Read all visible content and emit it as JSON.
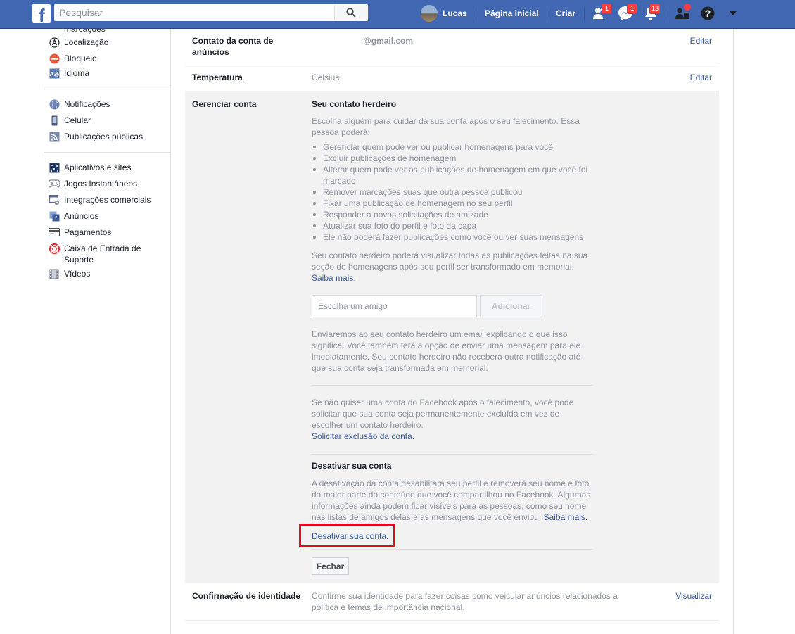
{
  "topbar": {
    "search_placeholder": "Pesquisar",
    "user_name": "Lucas",
    "home_label": "Página inicial",
    "create_label": "Criar",
    "friend_requests_badge": "1",
    "messages_badge": "1",
    "notifications_badge": "13",
    "brand_color": "#4267b2"
  },
  "sidebar": {
    "group1": [
      {
        "label": "marcações",
        "icon": "tag-icon"
      },
      {
        "label": "Localização",
        "icon": "location-icon"
      },
      {
        "label": "Bloqueio",
        "icon": "block-icon"
      },
      {
        "label": "Idioma",
        "icon": "language-icon"
      }
    ],
    "group2": [
      {
        "label": "Notificações",
        "icon": "globe-icon"
      },
      {
        "label": "Celular",
        "icon": "mobile-icon"
      },
      {
        "label": "Publicações públicas",
        "icon": "rss-icon"
      }
    ],
    "group3": [
      {
        "label": "Aplicativos e sites",
        "icon": "apps-icon"
      },
      {
        "label": "Jogos Instantâneos",
        "icon": "gamepad-icon"
      },
      {
        "label": "Integrações comerciais",
        "icon": "business-integrations-icon"
      },
      {
        "label": "Anúncios",
        "icon": "ads-icon"
      },
      {
        "label": "Pagamentos",
        "icon": "card-icon"
      },
      {
        "label": "Caixa de Entrada de Suporte",
        "icon": "lifebuoy-icon"
      },
      {
        "label": "Vídeos",
        "icon": "film-icon"
      }
    ]
  },
  "settings": {
    "ad_contact": {
      "label": "Contato da conta de anúncios",
      "value": "@gmail.com",
      "action": "Editar"
    },
    "temperature": {
      "label": "Temperatura",
      "value": "Celsius",
      "action": "Editar"
    },
    "manage_account": {
      "label": "Gerenciar conta",
      "legacy_title": "Seu contato herdeiro",
      "legacy_intro": "Escolha alguém para cuidar da sua conta após o seu falecimento. Essa pessoa poderá:",
      "legacy_bullets": [
        "Gerenciar quem pode ver ou publicar homenagens para você",
        "Excluir publicações de homenagem",
        "Alterar quem pode ver as publicações de homenagem em que você foi marcado",
        "Remover marcações suas que outra pessoa publicou",
        "Fixar uma publicação de homenagem no seu perfil",
        "Responder a novas solicitações de amizade",
        "Atualizar sua foto do perfil e foto da capa",
        "Ele não poderá fazer publicações como você ou ver suas mensagens"
      ],
      "legacy_view_text": "Seu contato herdeiro poderá visualizar todas as publicações feitas na sua seção de homenagens após seu perfil ser transformado em memorial.",
      "learn_more": "Saiba mais",
      "friend_placeholder": "Escolha um amigo",
      "add_button": "Adicionar",
      "email_text": "Enviaremos ao seu contato herdeiro um email explicando o que isso significa. Você também terá a opção de enviar uma mensagem para ele imediatamente. Seu contato herdeiro não receberá outra notificação até que sua conta seja transformada em memorial.",
      "delete_text": "Se não quiser uma conta do Facebook após o falecimento, você pode solicitar que sua conta seja permanentemente excluída em vez de escolher um contato herdeiro.",
      "delete_link": "Solicitar exclusão da conta.",
      "deactivate_title": "Desativar sua conta",
      "deactivate_text": "A desativação da conta desabilitará seu perfil e removerá seu nome e foto da maior parte do conteúdo que você compartilhou no Facebook. Algumas informações ainda podem ficar visíveis para as pessoas, como seu nome nas listas de amigos delas e as mensagens que você enviou.",
      "deactivate_learn_more": "Saiba mais.",
      "deactivate_link": "Desativar sua conta.",
      "close_button": "Fechar",
      "highlight_color": "#e00b1c"
    },
    "identity": {
      "label": "Confirmação de identidade",
      "value": "Confirme sua identidade para fazer coisas como veicular anúncios relacionados a política e temas de importância nacional.",
      "action": "Visualizar"
    }
  }
}
